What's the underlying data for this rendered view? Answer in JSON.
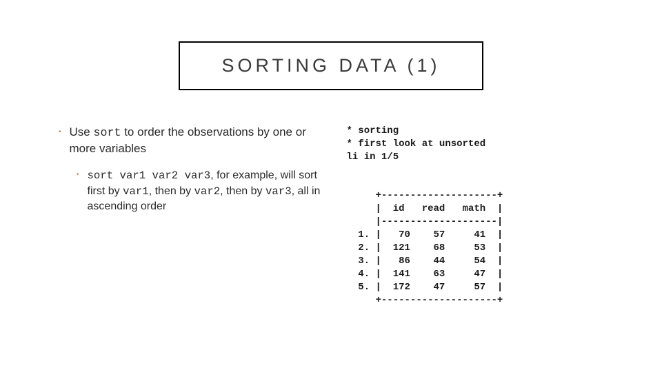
{
  "title": "SORTING DATA (1)",
  "left": {
    "bullet1": {
      "pre": "Use ",
      "cmd": "sort",
      "post": " to order the observations by one or more variables"
    },
    "sub1": {
      "cmd": "sort var1 var2 var3",
      "t1": ", for example, will sort first by ",
      "v1": "var1",
      "t2": ", then by ",
      "v2": "var2",
      "t3": ", then by ",
      "v3": "var3",
      "t4": ", all in ascending order"
    }
  },
  "right": {
    "code": "* sorting\n* first look at unsorted\nli in 1/5\n\n\n     +--------------------+\n     |  id   read   math  |\n     |--------------------|\n  1. |   70    57     41  |\n  2. |  121    68     53  |\n  3. |   86    44     54  |\n  4. |  141    63     47  |\n  5. |  172    47     57  |\n     +--------------------+"
  },
  "chart_data": {
    "type": "table",
    "title": "first look at unsorted (li in 1/5)",
    "columns": [
      "id",
      "read",
      "math"
    ],
    "rows": [
      {
        "n": 1,
        "id": 70,
        "read": 57,
        "math": 41
      },
      {
        "n": 2,
        "id": 121,
        "read": 68,
        "math": 53
      },
      {
        "n": 3,
        "id": 86,
        "read": 44,
        "math": 54
      },
      {
        "n": 4,
        "id": 141,
        "read": 63,
        "math": 47
      },
      {
        "n": 5,
        "id": 172,
        "read": 47,
        "math": 57
      }
    ]
  }
}
